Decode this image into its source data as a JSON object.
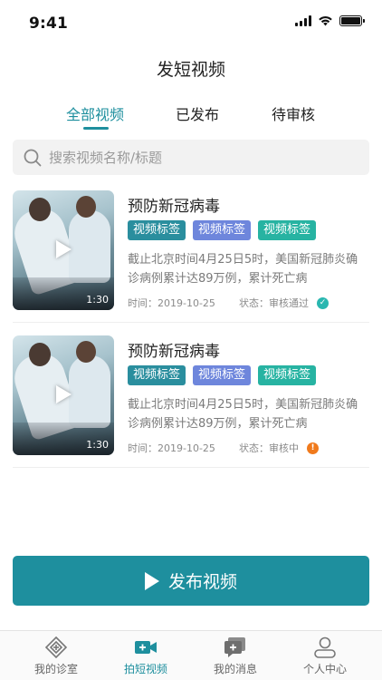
{
  "status_bar": {
    "time": "9:41"
  },
  "header": {
    "title": "发短视频"
  },
  "tabs": [
    {
      "label": "全部视频",
      "active": true
    },
    {
      "label": "已发布",
      "active": false
    },
    {
      "label": "待审核",
      "active": false
    }
  ],
  "search": {
    "placeholder": "搜索视频名称/标题",
    "value": ""
  },
  "videos": [
    {
      "title": "预防新冠病毒",
      "tags": [
        "视频标签",
        "视频标签",
        "视频标签"
      ],
      "description": "截止北京时间4月25日5时，美国新冠肺炎确诊病例累计达89万例，累计死亡病",
      "time_label": "时间：2019-10-25",
      "status_label": "状态：审核通过",
      "status_icon": "check-circle-icon",
      "status_color": "#2ab7b0",
      "duration": "1:30"
    },
    {
      "title": "预防新冠病毒",
      "tags": [
        "视频标签",
        "视频标签",
        "视频标签"
      ],
      "description": "截止北京时间4月25日5时，美国新冠肺炎确诊病例累计达89万例，累计死亡病",
      "time_label": "时间：2019-10-25",
      "status_label": "状态：审核中",
      "status_icon": "alert-circle-icon",
      "status_color": "#f07a1c",
      "duration": "1:30"
    }
  ],
  "publish_button": {
    "label": "发布视频"
  },
  "bottom_nav": [
    {
      "label": "我的诊室",
      "icon": "clinic-icon",
      "active": false
    },
    {
      "label": "拍短视频",
      "icon": "video-camera-icon",
      "active": true
    },
    {
      "label": "我的消息",
      "icon": "message-icon",
      "active": false
    },
    {
      "label": "个人中心",
      "icon": "user-icon",
      "active": false
    }
  ],
  "colors": {
    "accent": "#1e8f9e",
    "tag_teal": "#2a8e9e",
    "tag_blue": "#6e86dc",
    "tag_green": "#27b3a2"
  }
}
